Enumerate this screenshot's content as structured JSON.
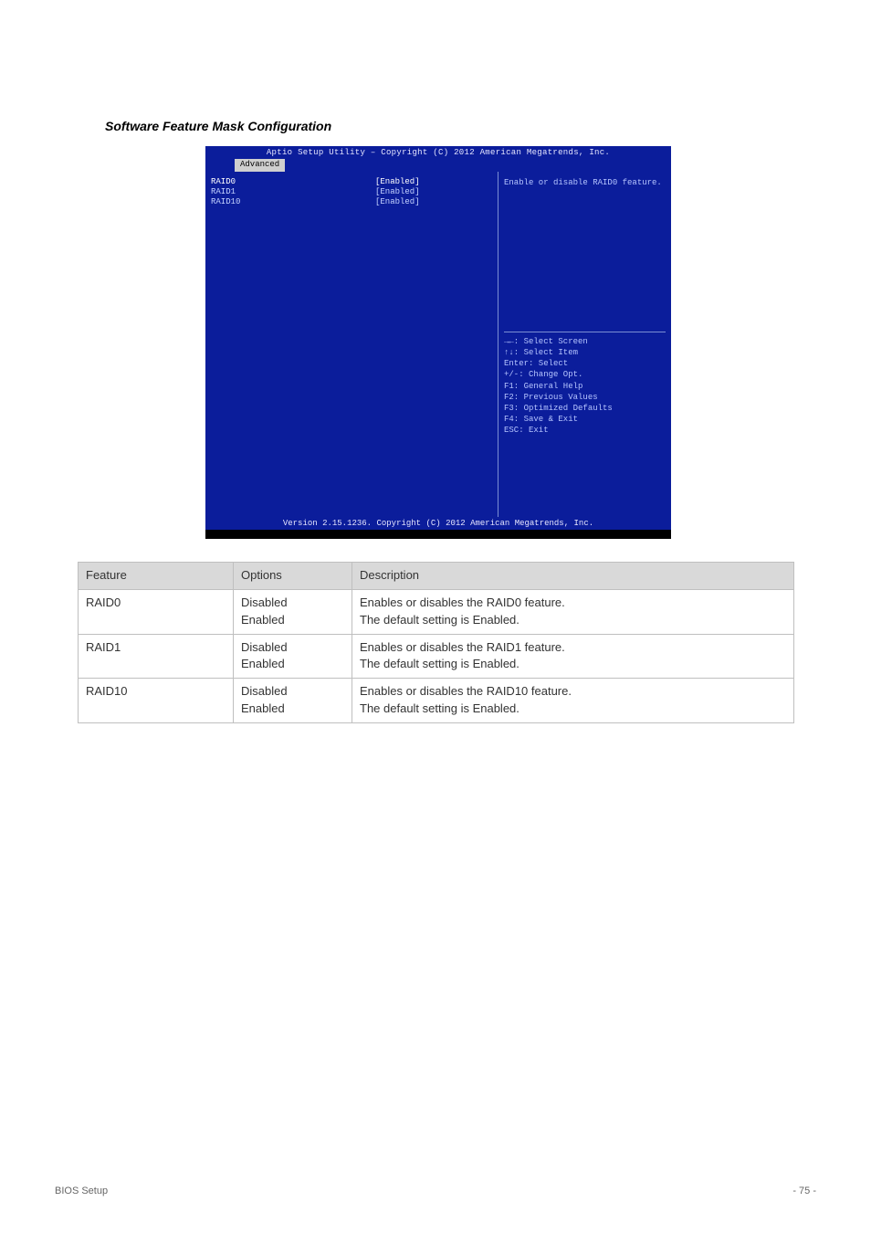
{
  "heading": "Software Feature Mask Configuration",
  "bios": {
    "title": "Aptio Setup Utility – Copyright (C) 2012 American Megatrends, Inc.",
    "tab": "Advanced",
    "items": [
      {
        "label": "RAID0",
        "value": "[Enabled]"
      },
      {
        "label": "RAID1",
        "value": "[Enabled]"
      },
      {
        "label": "RAID10",
        "value": "[Enabled]"
      }
    ],
    "help": "Enable or disable RAID0 feature.",
    "keys": {
      "k0": "→←: Select Screen",
      "k1": "↑↓: Select Item",
      "k2": "Enter: Select",
      "k3": "+/-: Change Opt.",
      "k4": "F1: General Help",
      "k5": "F2: Previous Values",
      "k6": "F3: Optimized Defaults",
      "k7": "F4: Save & Exit",
      "k8": "ESC: Exit"
    },
    "footer": "Version 2.15.1236. Copyright (C) 2012 American Megatrends, Inc."
  },
  "table": {
    "headers": {
      "h0": "Feature",
      "h1": "Options",
      "h2": "Description"
    },
    "rows": [
      {
        "feature": "RAID0",
        "options": "Disabled\nEnabled",
        "desc": "Enables or disables the RAID0 feature.\nThe default setting is Enabled."
      },
      {
        "feature": "RAID1",
        "options": "Disabled\nEnabled",
        "desc": "Enables or disables the RAID1 feature.\nThe default setting is Enabled."
      },
      {
        "feature": "RAID10",
        "options": "Disabled\nEnabled",
        "desc": "Enables or disables the RAID10 feature.\nThe default setting is Enabled."
      }
    ]
  },
  "footer": {
    "left": "BIOS Setup",
    "right": "- 75 -"
  }
}
